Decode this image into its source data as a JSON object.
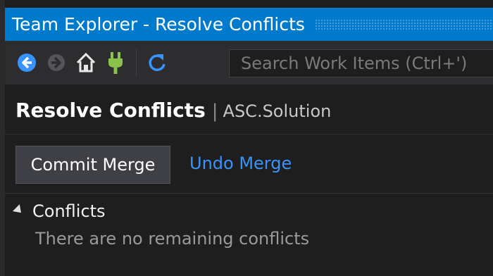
{
  "window": {
    "title": "Team Explorer - Resolve Conflicts"
  },
  "toolbar": {
    "buttons": [
      "back-icon",
      "forward-icon",
      "home-icon",
      "connect-icon",
      "refresh-icon"
    ],
    "search": {
      "placeholder": "Search Work Items (Ctrl+')",
      "value": ""
    }
  },
  "page": {
    "title": "Resolve Conflicts",
    "separator": "|",
    "context": "ASC.Solution"
  },
  "actions": {
    "commit_label": "Commit Merge",
    "undo_label": "Undo Merge"
  },
  "conflicts": {
    "header": "Conflicts",
    "empty_message": "There are no remaining conflicts"
  },
  "colors": {
    "accent": "#007acc",
    "background": "#1e1e1e",
    "toolbar": "#2d2d30",
    "link": "#3794ff",
    "connect_icon": "#8bc34a",
    "nav_back": "#3794ff"
  }
}
